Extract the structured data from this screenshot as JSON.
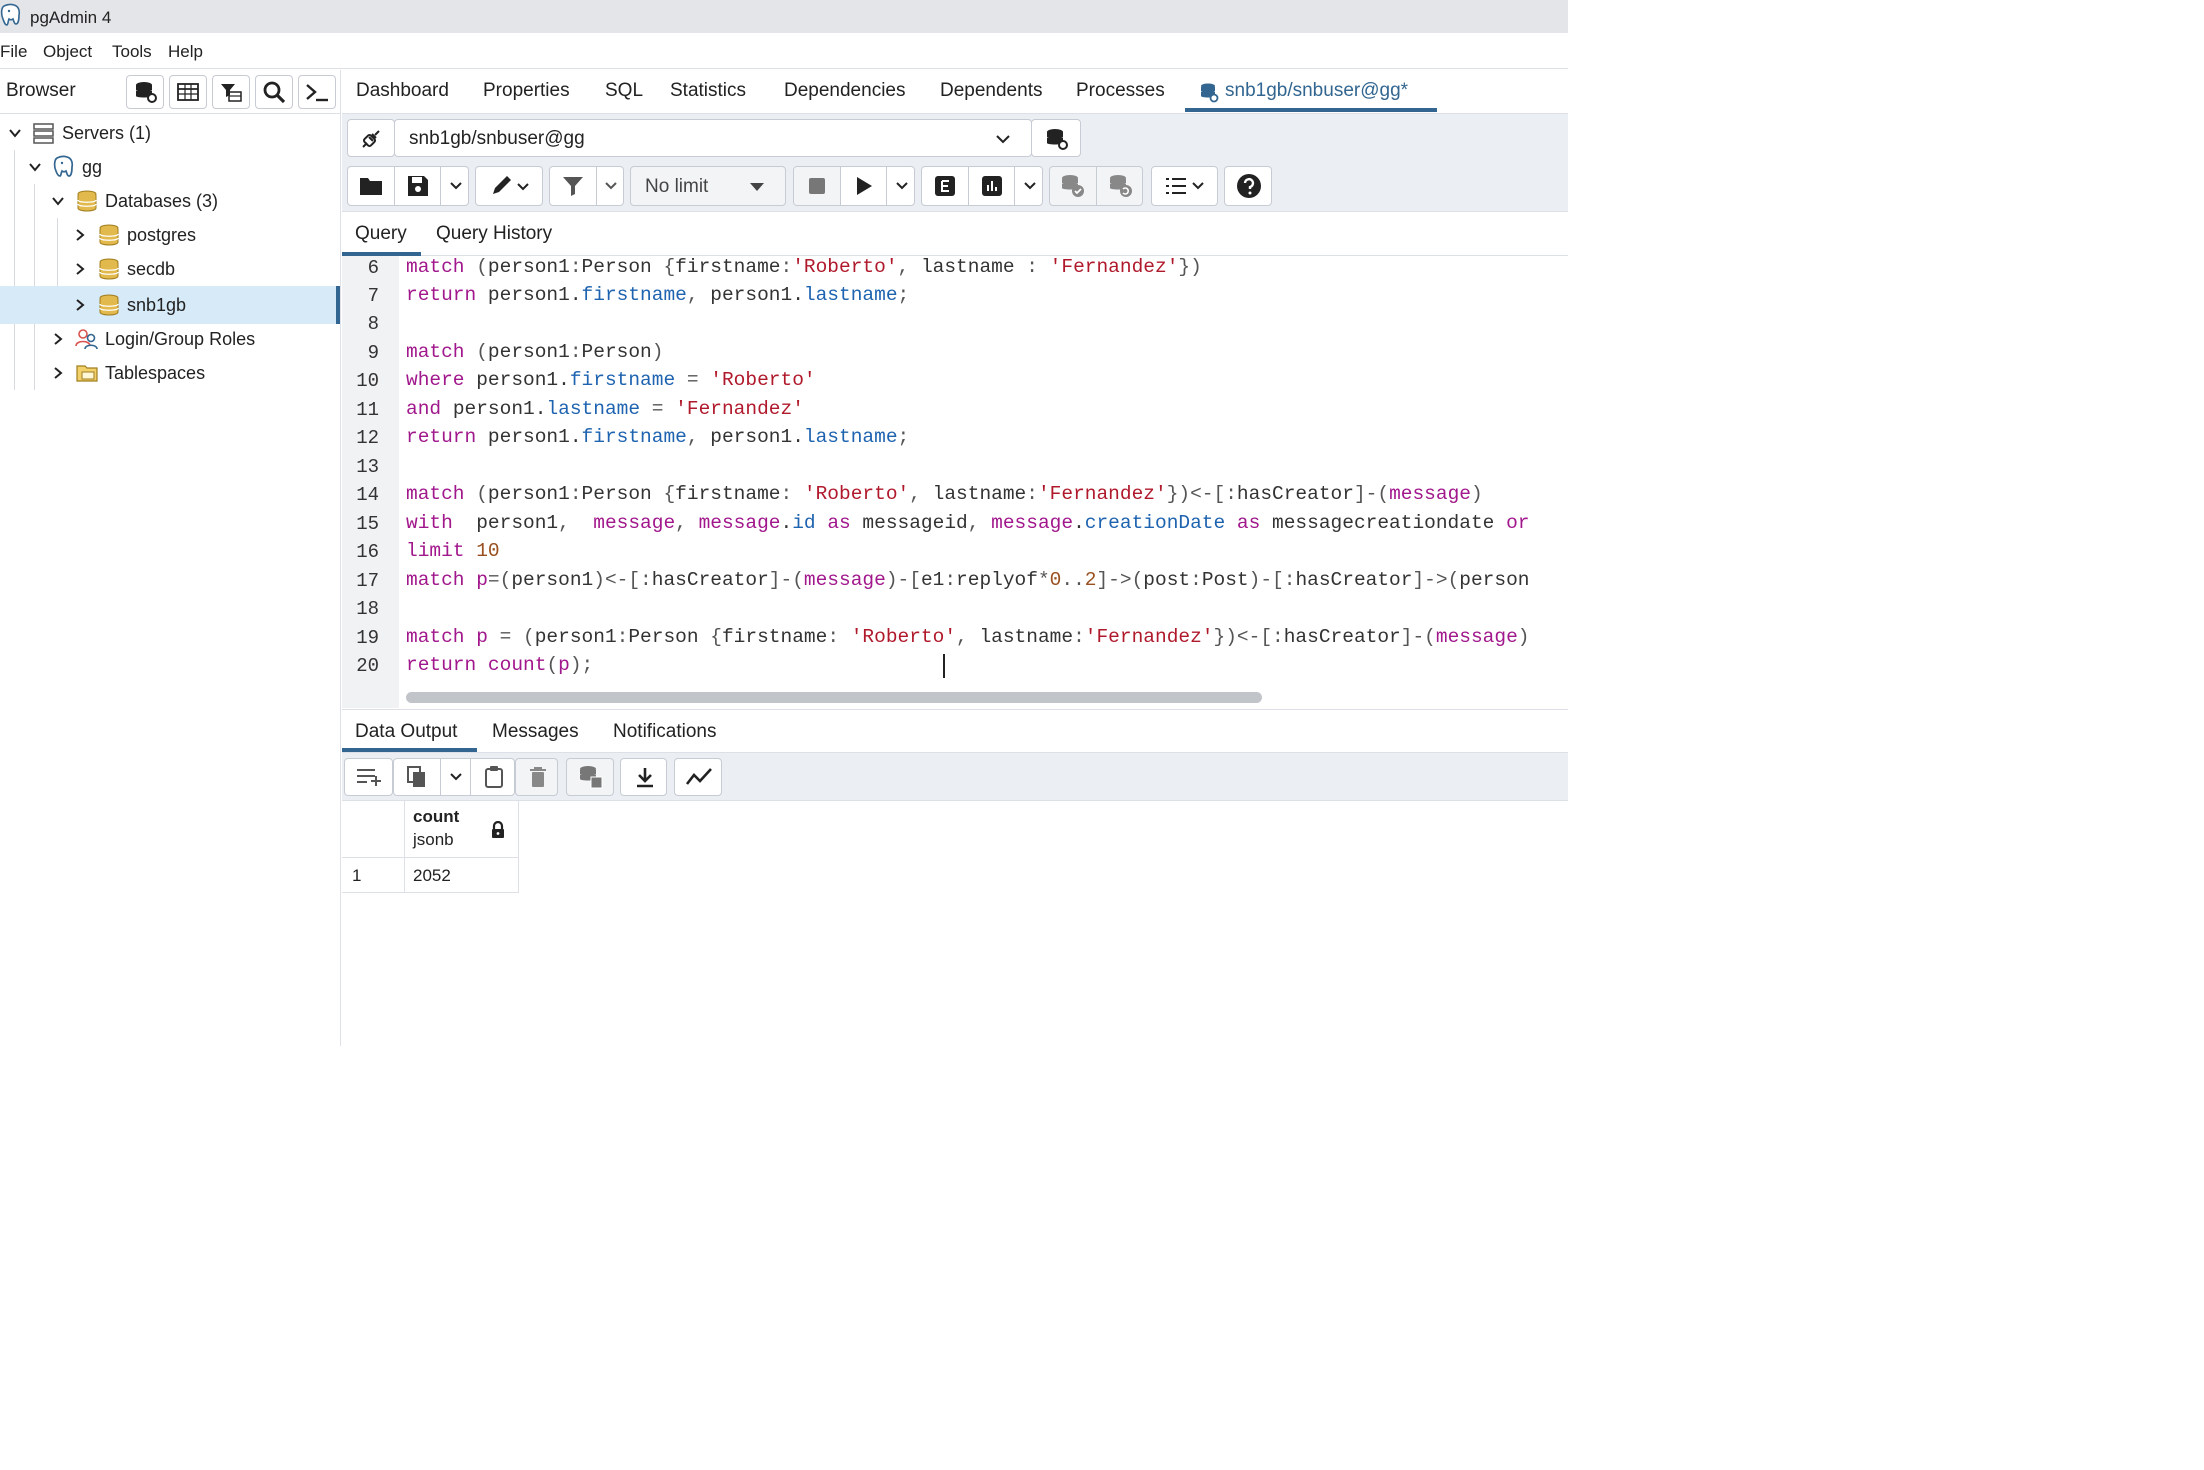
{
  "window": {
    "title": "pgAdmin 4"
  },
  "menu": [
    "File",
    "Object",
    "Tools",
    "Help"
  ],
  "browser": {
    "label": "Browser",
    "tree": [
      {
        "label": "Servers (1)"
      },
      {
        "label": "gg"
      },
      {
        "label": "Databases (3)"
      },
      {
        "label": "postgres"
      },
      {
        "label": "secdb"
      },
      {
        "label": "snb1gb"
      },
      {
        "label": "Login/Group Roles"
      },
      {
        "label": "Tablespaces"
      }
    ]
  },
  "main_tabs": [
    "Dashboard",
    "Properties",
    "SQL",
    "Statistics",
    "Dependencies",
    "Dependents",
    "Processes",
    "snb1gb/snbuser@gg*"
  ],
  "connection": {
    "value": "snb1gb/snbuser@gg"
  },
  "toolbar": {
    "row_limit": "No limit"
  },
  "query_tabs": [
    "Query",
    "Query History"
  ],
  "editor": {
    "line_numbers": [
      "6",
      "7",
      "8",
      "9",
      "10",
      "11",
      "12",
      "13",
      "14",
      "15",
      "16",
      "17",
      "18",
      "19",
      "20"
    ],
    "lines": [
      "match (person1:Person {firstname:'Roberto', lastname : 'Fernandez'})",
      "return person1.firstname, person1.lastname;",
      "",
      "match (person1:Person)",
      "where person1.firstname = 'Roberto'",
      "and person1.lastname = 'Fernandez'",
      "return person1.firstname, person1.lastname;",
      "",
      "match (person1:Person {firstname: 'Roberto', lastname:'Fernandez'})<-[:hasCreator]-(message)",
      "with  person1,  message, message.id as messageid, message.creationDate as messagecreationdate or",
      "limit 10",
      "match p=(person1)<-[:hasCreator]-(message)-[e1:replyof*0..2]->(post:Post)-[:hasCreator]->(person",
      "",
      "match p = (person1:Person {firstname: 'Roberto', lastname:'Fernandez'})<-[:hasCreator]-(message)",
      "return count(p);"
    ]
  },
  "output_tabs": [
    "Data Output",
    "Messages",
    "Notifications"
  ],
  "grid": {
    "columns": [
      {
        "name": "count",
        "type": "jsonb"
      }
    ],
    "rows": [
      {
        "index": "1",
        "values": [
          "2052"
        ]
      }
    ]
  },
  "colors": {
    "accent": "#326690",
    "keyword": "#a1178c",
    "string": "#b0192b",
    "property": "#1e63b0",
    "number": "#99501e"
  }
}
